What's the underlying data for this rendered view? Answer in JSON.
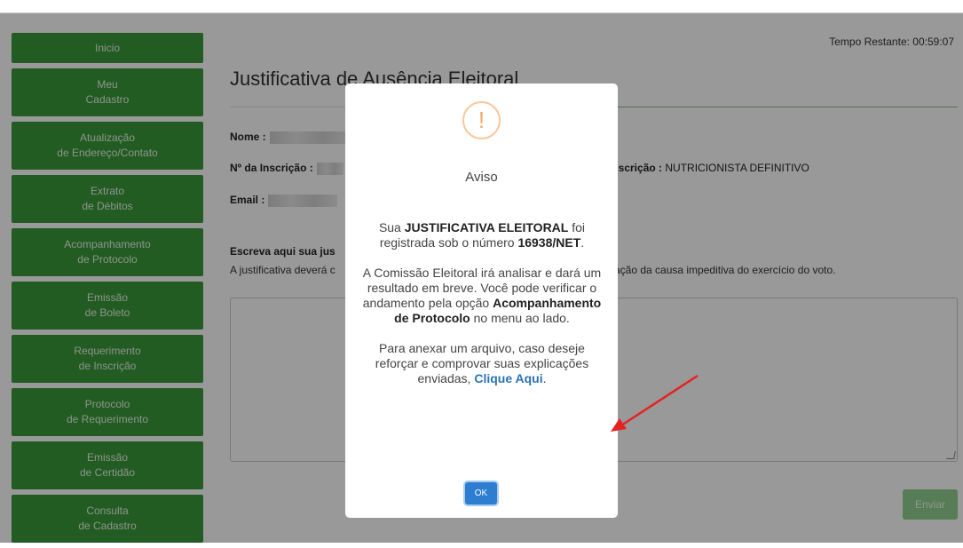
{
  "sidebar": {
    "items": [
      {
        "line1": "Inicio",
        "line2": ""
      },
      {
        "line1": "Meu",
        "line2": "Cadastro"
      },
      {
        "line1": "Atualização",
        "line2": "de Endereço/Contato"
      },
      {
        "line1": "Extrato",
        "line2": "de Débitos"
      },
      {
        "line1": "Acompanhamento",
        "line2": "de Protocolo"
      },
      {
        "line1": "Emissão",
        "line2": "de Boleto"
      },
      {
        "line1": "Requerimento",
        "line2": "de Inscrição"
      },
      {
        "line1": "Protocolo",
        "line2": "de Requerimento"
      },
      {
        "line1": "Emissão",
        "line2": "de Certidão"
      },
      {
        "line1": "Consulta",
        "line2": "de Cadastro"
      }
    ]
  },
  "header": {
    "timer": "Tempo Restante: 00:59:07",
    "title": "Justificativa de Ausência Eleitoral"
  },
  "form": {
    "nome_label": "Nome :",
    "inscricao_label": "Nº da Inscrição :",
    "tipo_inscricao_label": "Inscrição :",
    "tipo_inscricao_value": "NUTRICIONISTA DEFINITIVO",
    "email_label": "Email :",
    "justificativa_title": "Escreva aqui sua jus",
    "justificativa_help_left": "A justificativa deverá c",
    "justificativa_help_right": "vação da causa impeditiva do exercício do voto.",
    "send_label": "Enviar"
  },
  "modal": {
    "icon": "!",
    "title": "Aviso",
    "p1_pre": "Sua ",
    "p1_bold": "JUSTIFICATIVA ELEITORAL",
    "p1_mid": " foi registrada sob o número ",
    "p1_number": "16938/NET",
    "p1_end": ".",
    "p2_pre": "A Comissão Eleitoral irá analisar e dará um resultado em breve. Você pode verificar o andamento pela opção ",
    "p2_bold": "Acompanhamento de Protocolo",
    "p2_end": " no menu ao lado.",
    "p3_pre": "Para anexar um arquivo, caso deseje reforçar e comprovar suas explicações enviadas, ",
    "p3_link": "Clique Aqui",
    "p3_end": ".",
    "ok_label": "OK"
  },
  "colors": {
    "sidebar": "#3a9a3a",
    "link": "#2a73b8",
    "ok_button": "#2d7ed1",
    "warning": "#f3a968",
    "arrow": "#e52222"
  }
}
